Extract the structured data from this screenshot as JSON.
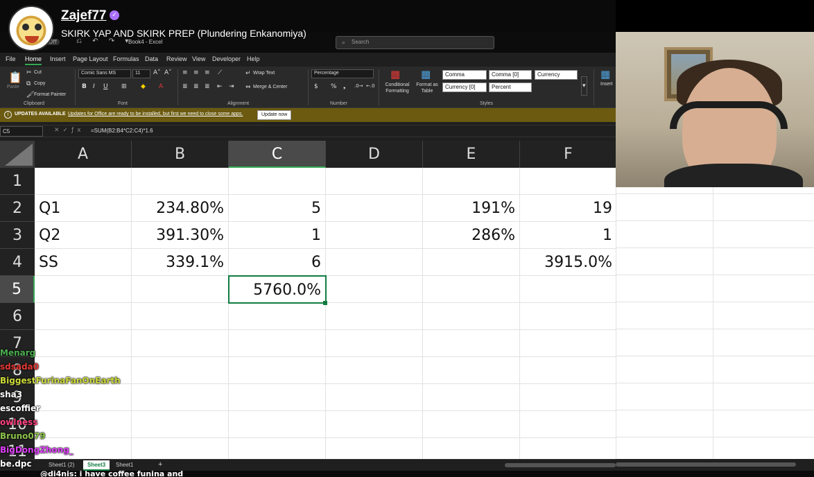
{
  "stream": {
    "streamer": "Zajef77",
    "title": "SKIRK YAP AND SKIRK PREP (Plundering Enkanomiya)"
  },
  "excel": {
    "autosave": "Off",
    "document_title": "Book4 - Excel",
    "search_placeholder": "Search",
    "menu": [
      "File",
      "Home",
      "Insert",
      "Page Layout",
      "Formulas",
      "Data",
      "Review",
      "View",
      "Developer",
      "Help"
    ],
    "active_menu": "Home",
    "ribbon": {
      "clipboard": {
        "paste": "Paste",
        "cut": "Cut",
        "copy": "Copy",
        "format_painter": "Format Painter",
        "label": "Clipboard"
      },
      "font": {
        "name": "Comic Sans MS",
        "size": "11",
        "label": "Font"
      },
      "alignment": {
        "wrap_text": "Wrap Text",
        "merge_center": "Merge & Center",
        "label": "Alignment"
      },
      "number": {
        "format": "Percentage",
        "label": "Number"
      },
      "styles": {
        "conditional": "Conditional Formatting",
        "format_table": "Format as Table",
        "cells": [
          "Comma",
          "Comma [0]",
          "Currency",
          "Currency [0]",
          "Percent"
        ],
        "label": "Styles"
      },
      "insert": "Insert"
    },
    "update_bar": {
      "title": "UPDATES AVAILABLE",
      "message": "Updates for Office are ready to be installed, but first we need to close some apps.",
      "button": "Update now"
    },
    "name_box": "C5",
    "formula": "=SUM(B2:B4*C2:C4)*1.6",
    "columns": [
      "A",
      "B",
      "C",
      "D",
      "E",
      "F"
    ],
    "selected_column": "C",
    "rows": [
      "1",
      "2",
      "3",
      "4",
      "5",
      "6",
      "7",
      "8",
      "9",
      "10",
      "11"
    ],
    "selected_row": "5",
    "cells": {
      "A2": "Q1",
      "B2": "234.80%",
      "C2": "5",
      "E2": "191%",
      "F2": "19",
      "A3": "Q2",
      "B3": "391.30%",
      "C3": "1",
      "E3": "286%",
      "F3": "1",
      "A4": "SS",
      "B4": "339.1%",
      "C4": "6",
      "F4": "3915.0%",
      "C5": "5760.0%"
    },
    "sheet_tabs": [
      "Sheet1 (2)",
      "Sheet3",
      "Sheet1"
    ],
    "active_sheet": "Sheet3",
    "add_sheet": "+"
  },
  "chat": [
    {
      "user": "Menarg",
      "color": "#4caf50",
      "text": ""
    },
    {
      "user": "sdsada0",
      "color": "#e53935",
      "text": ""
    },
    {
      "user": "BiggestFurinaFanOnEarth",
      "color": "#cddc39",
      "text": ""
    },
    {
      "user": "sha3",
      "color": "#ffffff",
      "text": ""
    },
    {
      "user": "escoffier",
      "color": "#ffffff",
      "text": ""
    },
    {
      "user": "owlness",
      "color": "#ff4081",
      "text": ""
    },
    {
      "user": "Bruno079",
      "color": "#8bc34a",
      "text": ""
    },
    {
      "user": "BigDongZhong_",
      "color": "#e040fb",
      "text": ""
    },
    {
      "user": "be.dpc",
      "color": "#ffffff",
      "text": ""
    }
  ],
  "bottom_chat": "@di4nis: i have coffee funina and"
}
